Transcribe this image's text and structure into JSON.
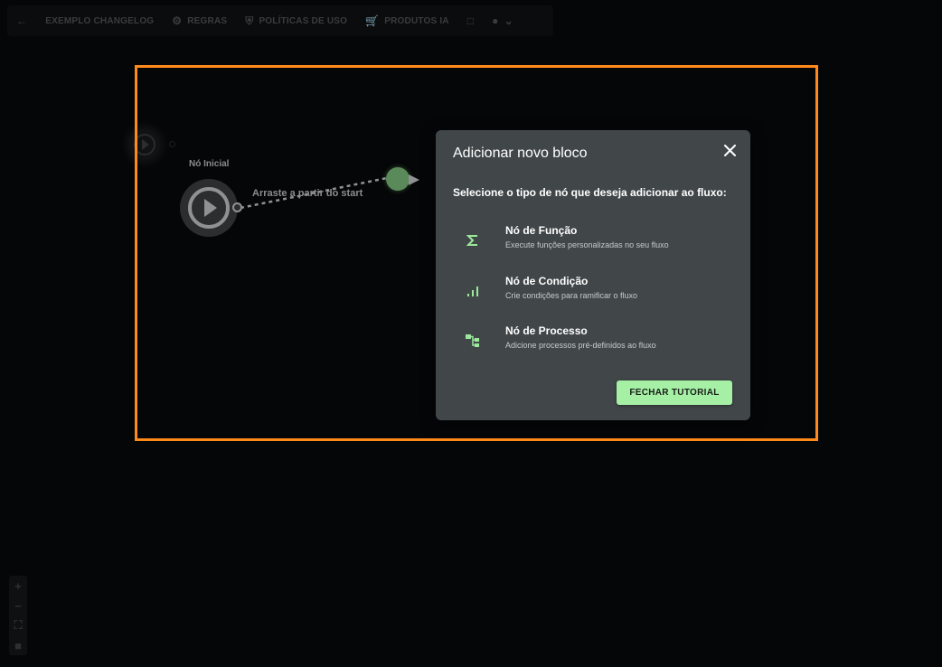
{
  "toolbar": {
    "items": [
      {
        "label": "EXEMPLO CHANGELOG",
        "icon": "back-arrow-icon"
      },
      {
        "label": "REGRAS",
        "icon": "gear-icon"
      },
      {
        "label": "POLÍTICAS DE USO",
        "icon": "shield-icon"
      },
      {
        "label": "PRODUTOS IA",
        "icon": "cart-icon"
      }
    ]
  },
  "canvas": {
    "start_node_label": "Nó Inicial",
    "drag_hint": "Arraste a partir do start"
  },
  "dialog": {
    "title": "Adicionar novo bloco",
    "subtitle": "Selecione o tipo de nó que deseja adicionar ao fluxo:",
    "options": [
      {
        "title": "Nó de Função",
        "description": "Execute funções personalizadas no seu fluxo",
        "icon": "sigma-icon"
      },
      {
        "title": "Nó de Condição",
        "description": "Crie condições para ramificar o fluxo",
        "icon": "signal-bars-icon"
      },
      {
        "title": "Nó de Processo",
        "description": "Adicione processos pré-definidos ao fluxo",
        "icon": "process-tree-icon"
      }
    ],
    "close_tutorial_label": "FECHAR TUTORIAL"
  },
  "colors": {
    "highlight": "#ff8a1c",
    "dialog_bg": "#414749",
    "accent_green": "#a5f0a5",
    "drag_dot": "#5a8a5a"
  }
}
